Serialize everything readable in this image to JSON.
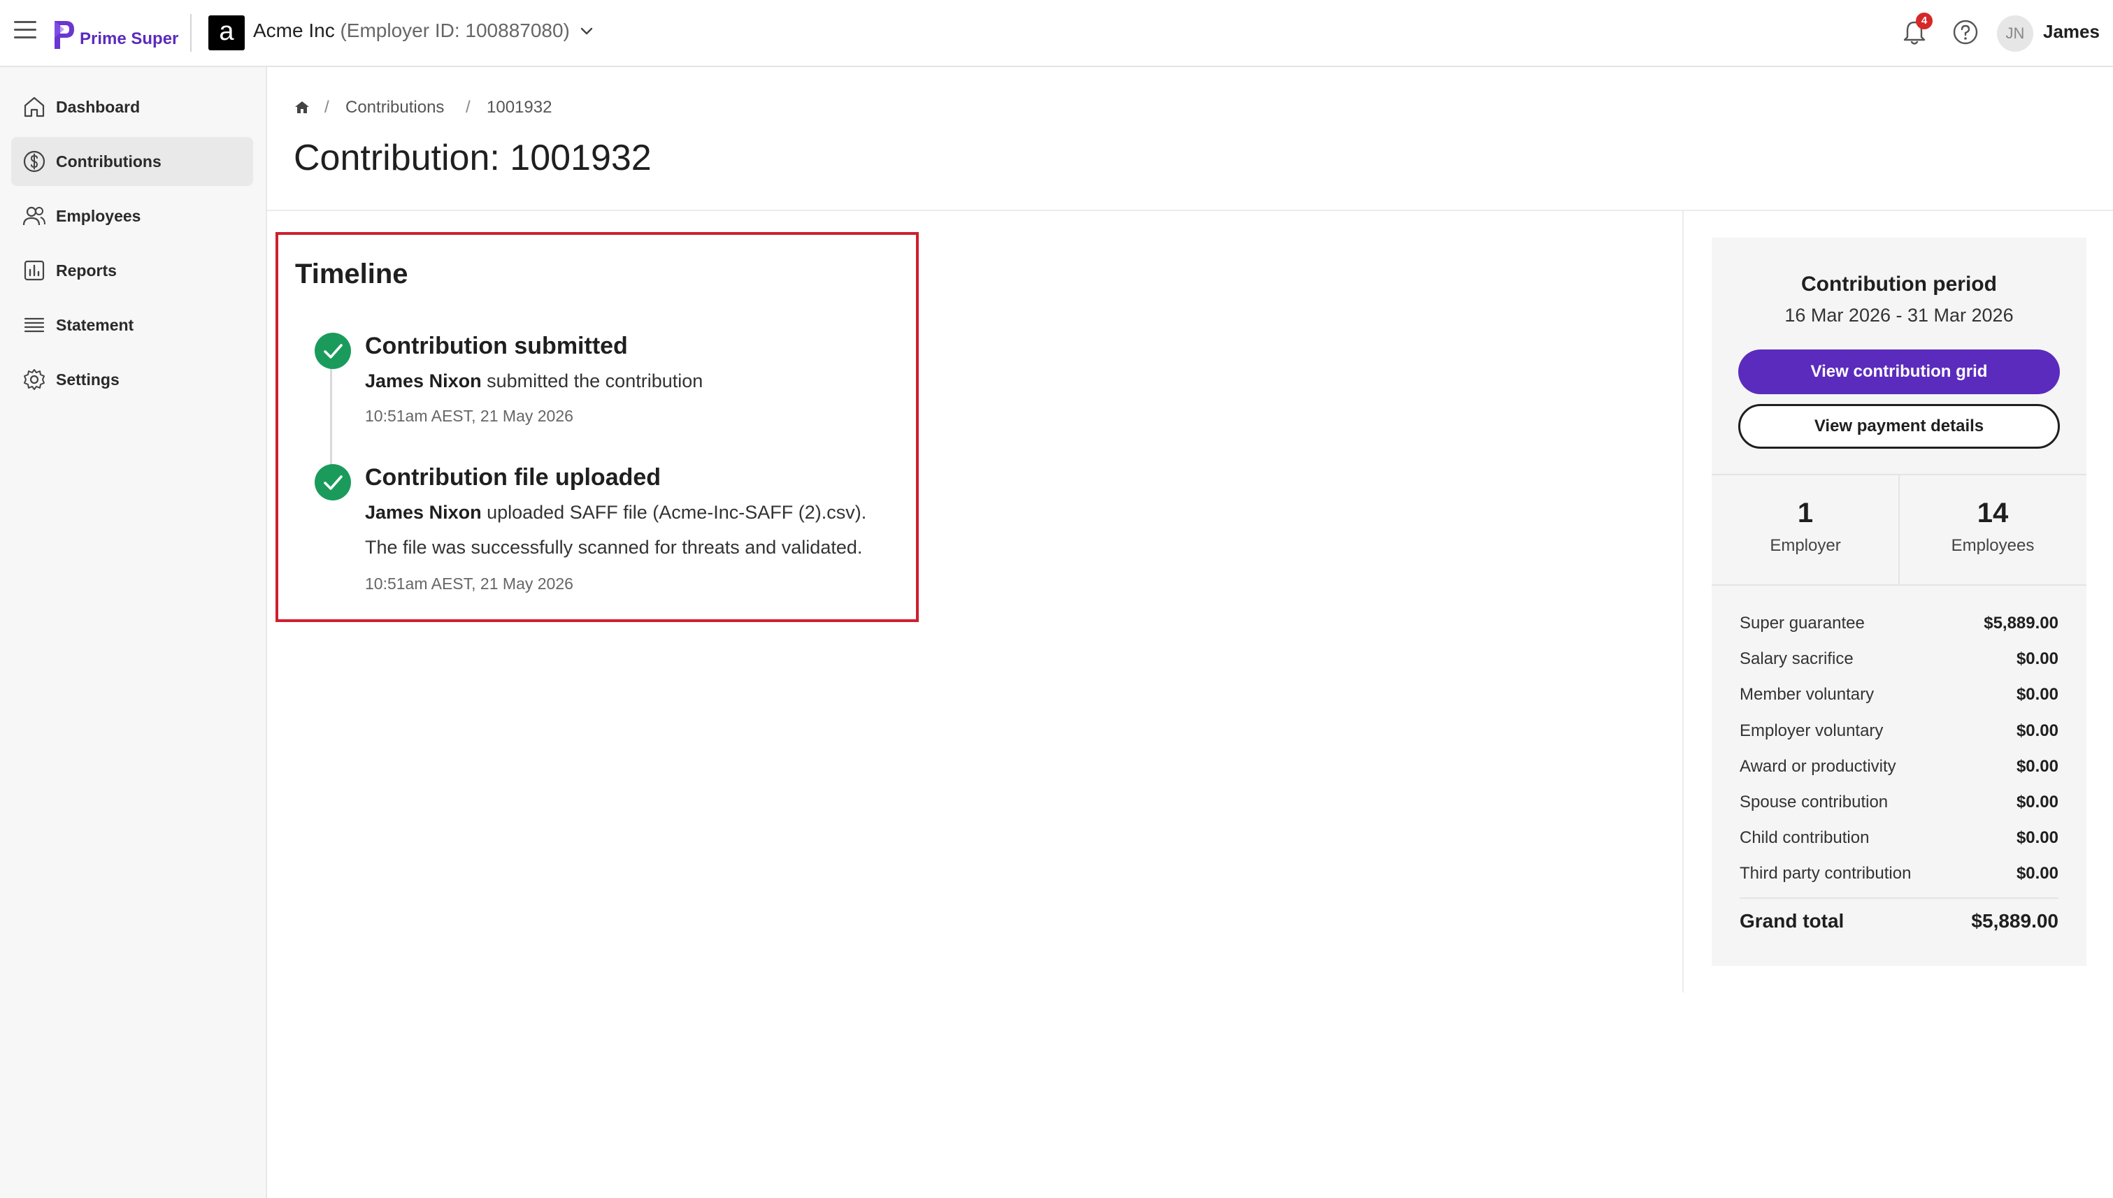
{
  "header": {
    "brand": "Prime Super",
    "employer_badge": "a",
    "employer_name": "Acme Inc",
    "employer_id": "(Employer ID: 100887080)",
    "notification_count": "4",
    "user_initials": "JN",
    "user_name": "James",
    "brand_color": "#5b2bbd"
  },
  "sidebar": {
    "items": [
      {
        "label": "Dashboard",
        "icon": "home-icon"
      },
      {
        "label": "Contributions",
        "icon": "dollar-circle-icon",
        "active": true
      },
      {
        "label": "Employees",
        "icon": "users-icon"
      },
      {
        "label": "Reports",
        "icon": "bar-chart-icon"
      },
      {
        "label": "Statement",
        "icon": "list-icon"
      },
      {
        "label": "Settings",
        "icon": "gear-icon"
      }
    ]
  },
  "breadcrumb": {
    "items": [
      "Contributions",
      "1001932"
    ]
  },
  "page": {
    "title": "Contribution: 1001932"
  },
  "timeline": {
    "title": "Timeline",
    "events": [
      {
        "heading": "Contribution submitted",
        "actor": "James Nixon",
        "text": " submitted the contribution",
        "time": "10:51am AEST, 21 May 2026"
      },
      {
        "heading": "Contribution file uploaded",
        "actor": "James Nixon",
        "text": " uploaded SAFF file (Acme-Inc-SAFF (2).csv).",
        "text2": "The file was successfully scanned for threats and validated.",
        "time": "10:51am AEST, 21 May 2026"
      }
    ],
    "check_color": "#1a9b5c",
    "highlight_color": "#cf1f2e"
  },
  "summary": {
    "period_title": "Contribution period",
    "period_dates": "16 Mar 2026 - 31 Mar 2026",
    "primary_button": "View contribution grid",
    "secondary_button": "View payment details",
    "stats": [
      {
        "value": "1",
        "label": "Employer"
      },
      {
        "value": "14",
        "label": "Employees"
      }
    ],
    "breakdown": [
      {
        "label": "Super guarantee",
        "value": "$5,889.00"
      },
      {
        "label": "Salary sacrifice",
        "value": "$0.00"
      },
      {
        "label": "Member voluntary",
        "value": "$0.00"
      },
      {
        "label": "Employer voluntary",
        "value": "$0.00"
      },
      {
        "label": "Award or productivity",
        "value": "$0.00"
      },
      {
        "label": "Spouse contribution",
        "value": "$0.00"
      },
      {
        "label": "Child contribution",
        "value": "$0.00"
      },
      {
        "label": "Third party contribution",
        "value": "$0.00"
      }
    ],
    "total_label": "Grand total",
    "total_value": "$5,889.00"
  }
}
